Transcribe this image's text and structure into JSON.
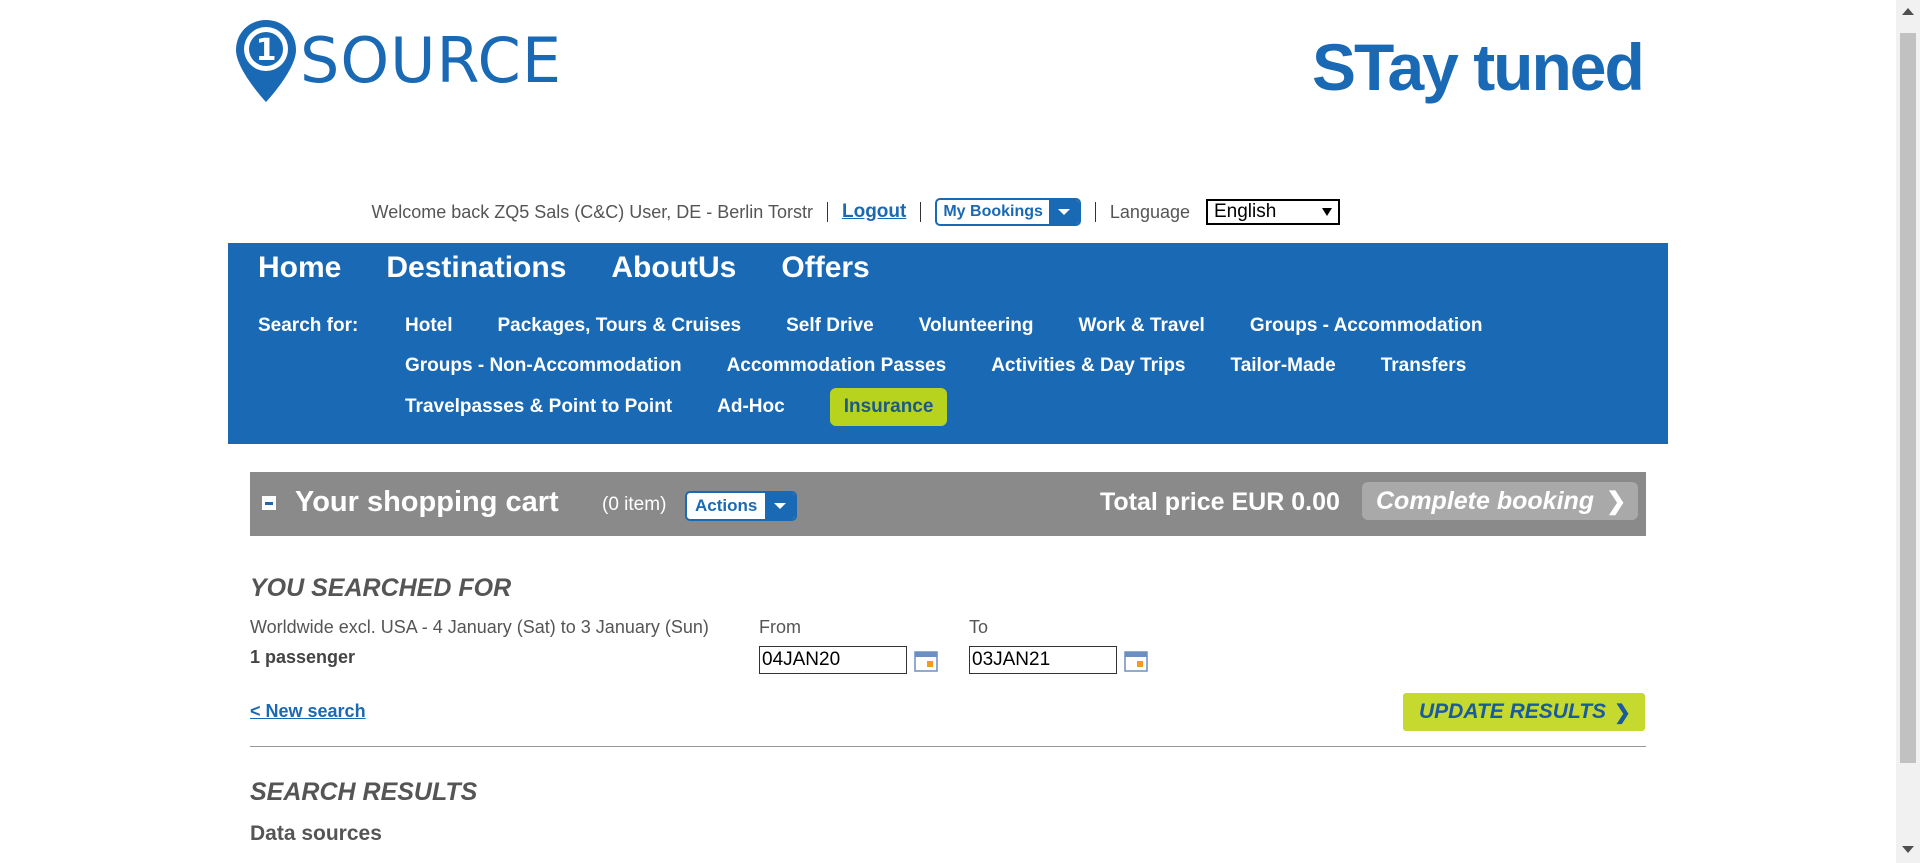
{
  "header": {
    "logo_left_text": "SOURCE",
    "logo_left_digit": "1",
    "logo_right_text": "STay tuned"
  },
  "util": {
    "welcome": "Welcome back ZQ5 Sals (C&C) User, DE - Berlin Torstr",
    "logout": "Logout",
    "my_bookings": "My Bookings",
    "language_label": "Language",
    "language_value": "English"
  },
  "nav": {
    "main": [
      "Home",
      "Destinations",
      "AboutUs",
      "Offers"
    ],
    "search_for": "Search for:",
    "row1": [
      "Hotel",
      "Packages, Tours & Cruises",
      "Self Drive",
      "Volunteering",
      "Work & Travel",
      "Groups - Accommodation"
    ],
    "row2": [
      "Groups - Non-Accommodation",
      "Accommodation Passes",
      "Activities & Day Trips",
      "Tailor-Made",
      "Transfers"
    ],
    "row3": [
      "Travelpasses & Point to Point",
      "Ad-Hoc",
      "Insurance"
    ],
    "active": "Insurance"
  },
  "cart": {
    "title": "Your shopping cart",
    "count": "(0 item)",
    "actions": "Actions",
    "total": "Total price EUR 0.00",
    "complete": "Complete booking"
  },
  "search": {
    "heading": "YOU SEARCHED FOR",
    "description": "Worldwide excl. USA - 4 January (Sat) to 3 January (Sun)",
    "passengers": "1 passenger",
    "from_label": "From",
    "from_value": "04JAN20",
    "to_label": "To",
    "to_value": "03JAN21",
    "new_search": "< New search",
    "update": "UPDATE RESULTS"
  },
  "results": {
    "heading": "SEARCH RESULTS",
    "data_sources": "Data sources"
  },
  "colors": {
    "brand_blue": "#1a69b4",
    "accent_green": "#b8d31e",
    "cart_gray": "#8a8a8a"
  }
}
